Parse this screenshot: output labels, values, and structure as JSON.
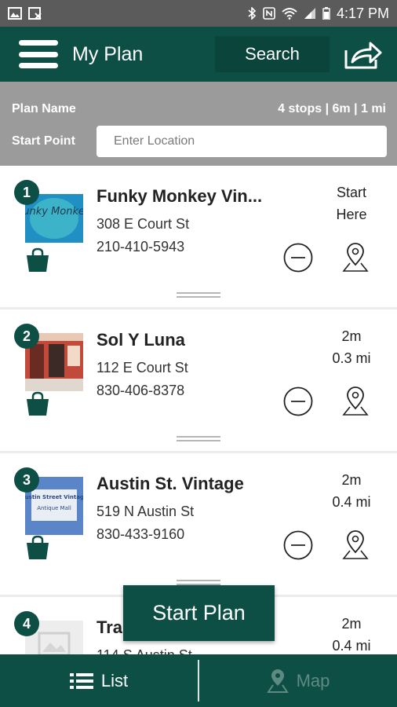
{
  "status_bar": {
    "time": "4:17 PM",
    "left_icons": [
      "image-icon",
      "photo-x-icon"
    ],
    "right_icons": [
      "bluetooth-icon",
      "nfc-icon",
      "wifi-icon",
      "signal-icon",
      "battery-icon"
    ]
  },
  "app_bar": {
    "title": "My Plan",
    "search_label": "Search",
    "menu_icon": "hamburger-menu-icon",
    "share_icon": "share-icon"
  },
  "plan": {
    "name_label": "Plan Name",
    "stats": "4 stops | 6m | 1 mi",
    "start_point_label": "Start Point",
    "start_point_placeholder": "Enter Location",
    "start_point_value": ""
  },
  "stops": [
    {
      "number": "1",
      "name": "Funky Monkey Vin...",
      "address": "308 E Court St",
      "phone": "210-410-5943",
      "meta_line1": "Start",
      "meta_line2": "Here",
      "thumb_text": "Funky Monkey"
    },
    {
      "number": "2",
      "name": "Sol Y Luna",
      "address": "112 E Court St",
      "phone": "830-406-8378",
      "meta_line1": "2m",
      "meta_line2": "0.3 mi"
    },
    {
      "number": "3",
      "name": "Austin St. Vintage",
      "address": "519 N Austin St",
      "phone": "830-433-9160",
      "meta_line1": "2m",
      "meta_line2": "0.4 mi",
      "thumb_text_1": "Austin Street Vintage",
      "thumb_text_2": "Antique Mall"
    },
    {
      "number": "4",
      "name": "Tra",
      "address": "114 S Austin St",
      "phone": "",
      "meta_line1": "2m",
      "meta_line2": "0.4 mi"
    }
  ],
  "start_plan_label": "Start Plan",
  "bottom_nav": {
    "list_label": "List",
    "map_label": "Map",
    "list_icon": "list-icon",
    "map_icon": "map-pin-icon"
  },
  "colors": {
    "primary": "#0d4f45",
    "header_gray": "#9b9b9b",
    "status_bar": "#5b5b5b",
    "map_tab_inactive": "#5e8a82"
  }
}
